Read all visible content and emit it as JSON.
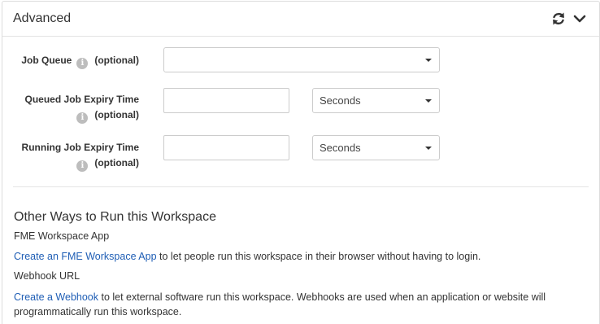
{
  "panel": {
    "title": "Advanced",
    "icons": [
      "refresh-icon",
      "chevron-down-icon"
    ]
  },
  "form": {
    "job_queue": {
      "label": "Job Queue",
      "optional": "(optional)",
      "value": ""
    },
    "queued_expiry": {
      "label": "Queued Job Expiry Time",
      "optional": "(optional)",
      "value": "",
      "unit": "Seconds"
    },
    "running_expiry": {
      "label": "Running Job Expiry Time",
      "optional": "(optional)",
      "value": "",
      "unit": "Seconds"
    },
    "info_glyph": "i"
  },
  "other_ways": {
    "title": "Other Ways to Run this Workspace",
    "app": {
      "heading": "FME Workspace App",
      "link": "Create an FME Workspace App",
      "text": " to let people run this workspace in their browser without having to login."
    },
    "webhook": {
      "heading": "Webhook URL",
      "link": "Create a Webhook",
      "text": " to let external software run this workspace. Webhooks are used when an application or website will programmatically run this workspace."
    }
  },
  "colors": {
    "link": "#1f5eb5",
    "info_badge": "#bdbdbd",
    "border": "#cccccc"
  }
}
